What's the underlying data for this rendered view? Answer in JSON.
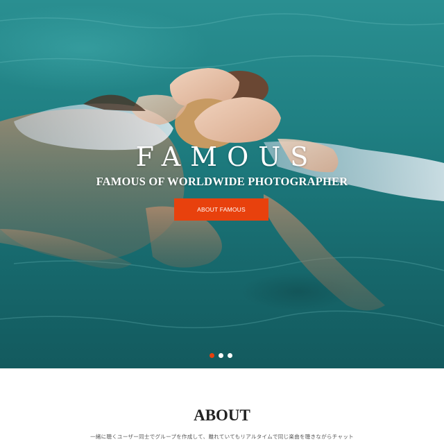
{
  "hero": {
    "title": "FAMOUS",
    "subtitle": "FAMOUS OF WORLDWIDE PHOTOGRAPHER",
    "cta_label": "ABOUT FAMOUS",
    "slides": 3,
    "active_slide": 1
  },
  "about": {
    "heading": "ABOUT",
    "text": "一緒に聴くユーザー同士でグループを作成して、離れていてもリアルタイムで同じ楽曲を聴きながらチャット"
  },
  "colors": {
    "accent": "#e8410d",
    "water": "#1f7f82",
    "background": "#ffffff"
  }
}
